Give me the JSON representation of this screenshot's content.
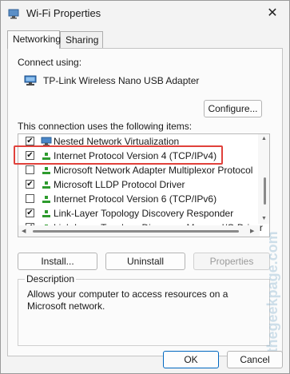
{
  "window": {
    "title": "Wi-Fi Properties",
    "close_glyph": "✕"
  },
  "tabs": [
    {
      "label": "Networking",
      "active": true
    },
    {
      "label": "Sharing",
      "active": false
    }
  ],
  "connect_using": {
    "label": "Connect using:",
    "adapter": "TP-Link Wireless Nano USB Adapter"
  },
  "buttons": {
    "configure": "Configure...",
    "install": "Install...",
    "uninstall": "Uninstall",
    "properties": "Properties",
    "ok": "OK",
    "cancel": "Cancel"
  },
  "items_label": "This connection uses the following items:",
  "items": [
    {
      "label": "Nested Network Virtualization",
      "checked": true,
      "icon": "network-icon"
    },
    {
      "label": "Internet Protocol Version 4 (TCP/IPv4)",
      "checked": true,
      "icon": "protocol-icon"
    },
    {
      "label": "Microsoft Network Adapter Multiplexor Protocol",
      "checked": false,
      "icon": "protocol-icon"
    },
    {
      "label": "Microsoft LLDP Protocol Driver",
      "checked": true,
      "icon": "protocol-icon"
    },
    {
      "label": "Internet Protocol Version 6 (TCP/IPv6)",
      "checked": false,
      "icon": "protocol-icon"
    },
    {
      "label": "Link-Layer Topology Discovery Responder",
      "checked": true,
      "icon": "protocol-icon"
    },
    {
      "label": "Link-Layer Topology Discovery Mapper I/O Driver",
      "checked": true,
      "icon": "protocol-icon"
    }
  ],
  "description": {
    "title": "Description",
    "text": "Allows your computer to access resources on a Microsoft network."
  },
  "watermark": "@thegeekpage.com",
  "colors": {
    "accent": "#0067c0",
    "highlight": "#e0413b",
    "protocol_green": "#2e9b2e"
  }
}
